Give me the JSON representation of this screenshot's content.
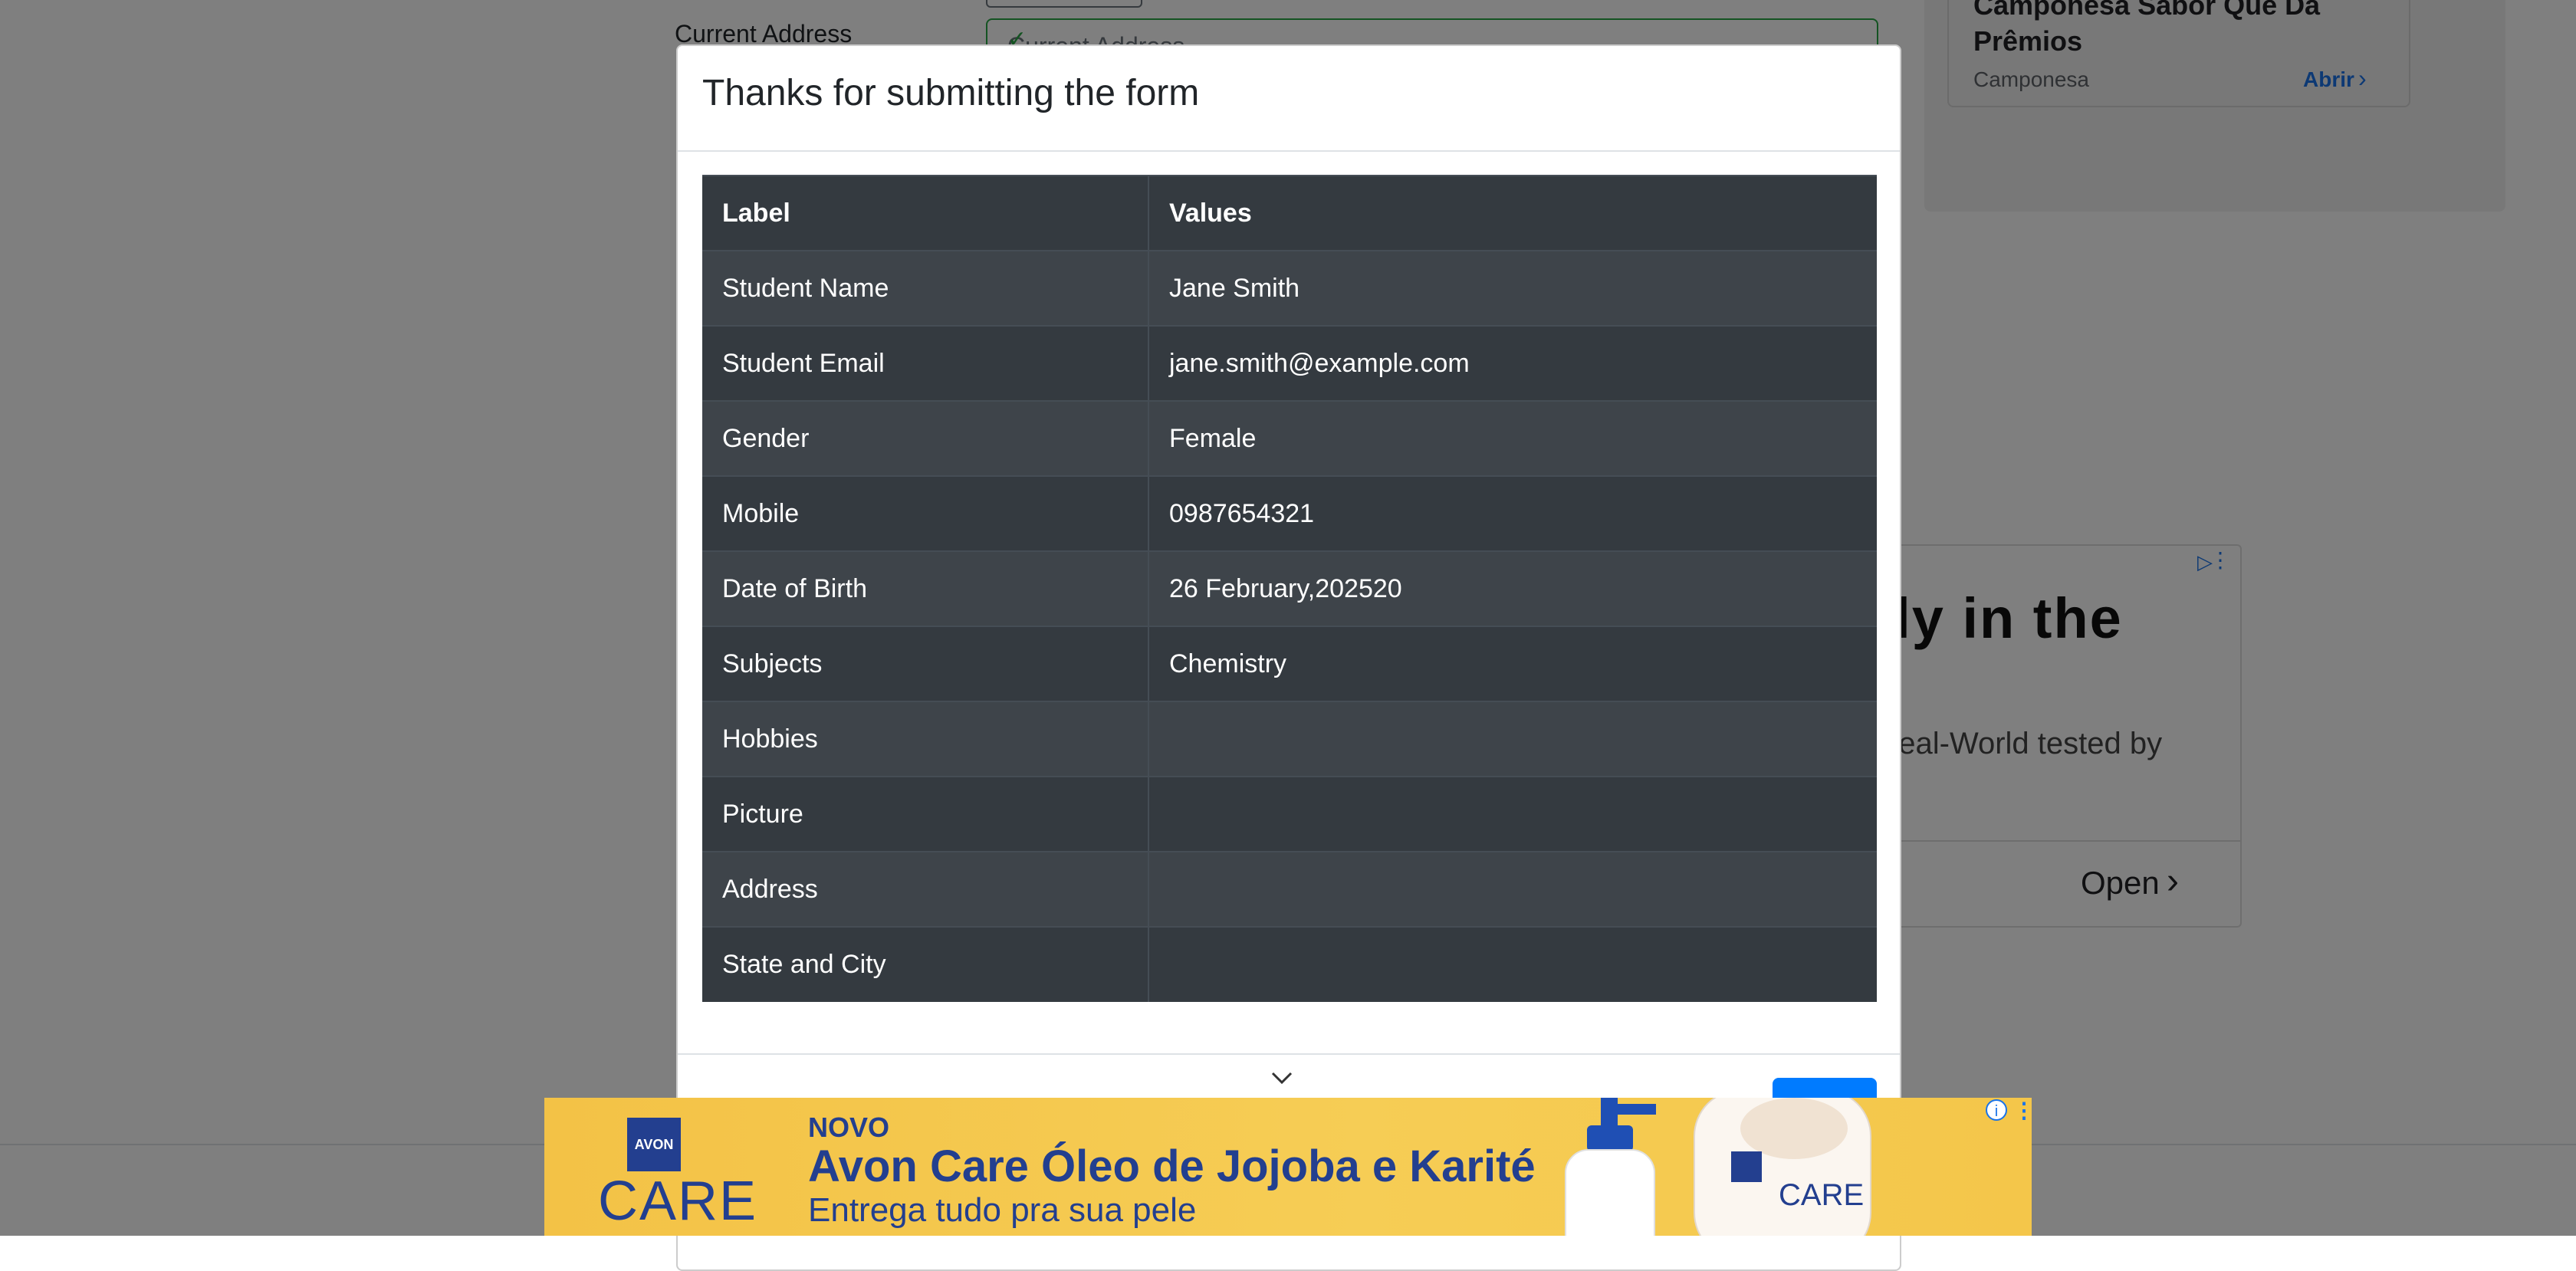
{
  "background": {
    "address_label": "Current Address",
    "address_placeholder": "Current Address",
    "top_ad": {
      "title": "Camponesa Sabor Que Dá Prêmios",
      "brand": "Camponesa",
      "cta": "Abrir"
    },
    "side_ad": {
      "headline": "nly in the",
      "subtext": "n Real-World tested by",
      "cta": "Open"
    }
  },
  "modal": {
    "title": "Thanks for submitting the form",
    "columns": [
      "Label",
      "Values"
    ],
    "rows": [
      {
        "label": "Student Name",
        "value": "Jane Smith"
      },
      {
        "label": "Student Email",
        "value": "jane.smith@example.com"
      },
      {
        "label": "Gender",
        "value": "Female"
      },
      {
        "label": "Mobile",
        "value": "0987654321"
      },
      {
        "label": "Date of Birth",
        "value": "26 February,202520"
      },
      {
        "label": "Subjects",
        "value": "Chemistry"
      },
      {
        "label": "Hobbies",
        "value": ""
      },
      {
        "label": "Picture",
        "value": ""
      },
      {
        "label": "Address",
        "value": ""
      },
      {
        "label": "State and City",
        "value": ""
      }
    ]
  },
  "banner_ad": {
    "logo_top": "AVON",
    "logo_bottom": "CARE",
    "kicker": "NOVO",
    "headline": "Avon Care Óleo de Jojoba e Karité",
    "subline": "Entrega tudo pra sua pele"
  },
  "colors": {
    "table_dark": "#343a40",
    "table_stripe": "#3e444a",
    "primary": "#007bff",
    "banner": "#f6cd55",
    "avon_blue": "#233f8f"
  }
}
